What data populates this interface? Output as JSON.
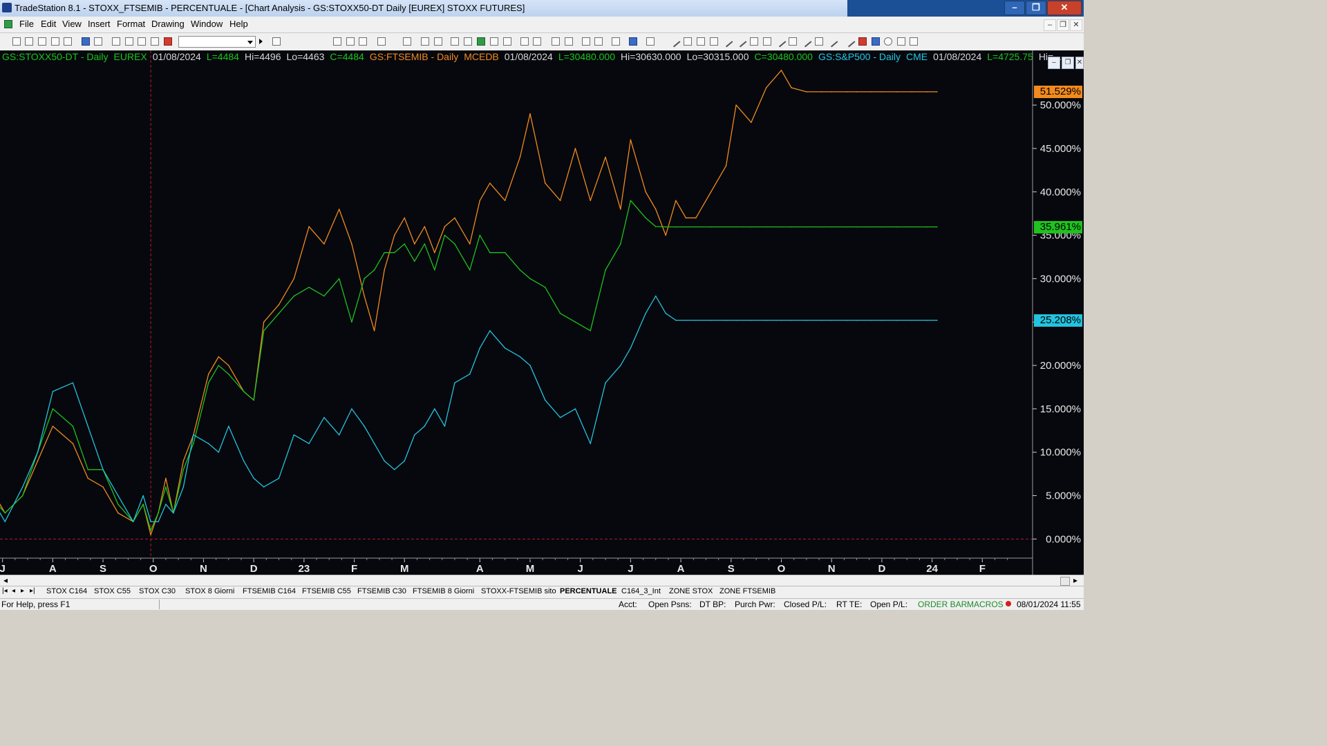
{
  "window": {
    "title": "TradeStation 8.1 - STOXX_FTSEMIB - PERCENTUALE - [Chart Analysis - GS:STOXX50-DT  Daily  [EUREX] STOXX FUTURES]",
    "minimize": "–",
    "restore": "❐",
    "close": "✕"
  },
  "menu": [
    "File",
    "Edit",
    "View",
    "Insert",
    "Format",
    "Drawing",
    "Window",
    "Help"
  ],
  "toolbar": {
    "symbol_value": ""
  },
  "info_bar": [
    {
      "text": "GS:STOXX50-DT - Daily",
      "color": "#19c619"
    },
    {
      "text": "EUREX",
      "color": "#19c619"
    },
    {
      "text": "01/08/2024",
      "color": "#d8d8d8"
    },
    {
      "text": "L=4484",
      "color": "#19c619"
    },
    {
      "text": "Hi=4496",
      "color": "#d8d8d8"
    },
    {
      "text": "Lo=4463",
      "color": "#d8d8d8"
    },
    {
      "text": "C=4484",
      "color": "#19c619"
    },
    {
      "text": "GS:FTSEMIB - Daily",
      "color": "#f28a1e"
    },
    {
      "text": "MCEDB",
      "color": "#f28a1e"
    },
    {
      "text": "01/08/2024",
      "color": "#d8d8d8"
    },
    {
      "text": "L=30480.000",
      "color": "#19c619"
    },
    {
      "text": "Hi=30630.000",
      "color": "#d8d8d8"
    },
    {
      "text": "Lo=30315.000",
      "color": "#d8d8d8"
    },
    {
      "text": "C=30480.000",
      "color": "#19c619"
    },
    {
      "text": "GS:S&P500 - Daily",
      "color": "#22c8e6"
    },
    {
      "text": "CME",
      "color": "#22c8e6"
    },
    {
      "text": "01/08/2024",
      "color": "#d8d8d8"
    },
    {
      "text": "L=4725.75",
      "color": "#19c619"
    },
    {
      "text": "Hi=...",
      "color": "#d8d8d8"
    }
  ],
  "chart_data": {
    "type": "line",
    "title": "",
    "ylabel": "",
    "ylim": [
      -2.2,
      55.5
    ],
    "y_ticks": [
      "50.000%",
      "45.000%",
      "40.000%",
      "35.000%",
      "30.000%",
      "25.000%",
      "20.000%",
      "15.000%",
      "10.000%",
      "5.000%",
      "0.000%"
    ],
    "y_tick_values": [
      50,
      45,
      40,
      35,
      30,
      25,
      20,
      15,
      10,
      5,
      0
    ],
    "x_labels": [
      "J",
      "A",
      "S",
      "O",
      "N",
      "D",
      "23",
      "F",
      "M",
      "A",
      "M",
      "J",
      "J",
      "A",
      "S",
      "O",
      "N",
      "D",
      "24",
      "F"
    ],
    "x_label_positions": [
      0.5,
      1.5,
      2.5,
      3.5,
      4.5,
      5.5,
      6.5,
      7.5,
      8.5,
      10,
      11,
      12,
      13,
      14,
      15,
      16,
      17,
      18,
      19,
      20
    ],
    "x_range": [
      0.45,
      21.0
    ],
    "vertical_marker_month": 3.45,
    "zero_line": 0,
    "grid": false,
    "series": [
      {
        "name": "GS:FTSEMIB",
        "color": "#f28a1e",
        "last_label": "51.529%",
        "last": 51.529,
        "x": [
          0,
          0.25,
          0.55,
          0.9,
          1.2,
          1.5,
          1.9,
          2.2,
          2.5,
          2.8,
          3.1,
          3.3,
          3.45,
          3.6,
          3.75,
          3.9,
          4.1,
          4.3,
          4.6,
          4.8,
          5.0,
          5.3,
          5.5,
          5.7,
          6.0,
          6.3,
          6.6,
          6.9,
          7.2,
          7.45,
          7.7,
          7.9,
          8.1,
          8.3,
          8.5,
          8.7,
          8.9,
          9.1,
          9.3,
          9.5,
          9.8,
          10.0,
          10.2,
          10.5,
          10.8,
          11.0,
          11.3,
          11.6,
          11.9,
          12.2,
          12.5,
          12.8,
          13.0,
          13.3,
          13.5,
          13.7,
          13.9,
          14.1,
          14.3,
          14.6,
          14.9,
          15.1,
          15.4,
          15.7,
          16.0,
          16.2,
          16.5,
          16.8,
          17.0,
          17.3,
          17.5,
          17.8,
          18.0,
          18.3,
          18.6,
          18.9,
          19.1
        ],
        "values": [
          19,
          6,
          3,
          5,
          9,
          13,
          11,
          7,
          6,
          3,
          2,
          4,
          0.5,
          3,
          7,
          3,
          9,
          12,
          19,
          21,
          20,
          17,
          16,
          25,
          27,
          30,
          36,
          34,
          38,
          34,
          28,
          24,
          31,
          35,
          37,
          34,
          36,
          33,
          36,
          37,
          34,
          39,
          41,
          39,
          44,
          49,
          41,
          39,
          45,
          39,
          44,
          38,
          46,
          40,
          38,
          35,
          39,
          37,
          37,
          40,
          43,
          50,
          48,
          52,
          54,
          52,
          51.529,
          51.529,
          51.529,
          51.529,
          51.529,
          51.529,
          51.529,
          51.529,
          51.529,
          51.529,
          51.529
        ]
      },
      {
        "name": "GS:STOXX50-DT",
        "color": "#1fc21f",
        "last_label": "35.961%",
        "last": 35.961,
        "x": [
          0,
          0.25,
          0.55,
          0.9,
          1.2,
          1.5,
          1.9,
          2.2,
          2.5,
          2.8,
          3.1,
          3.3,
          3.45,
          3.6,
          3.75,
          3.9,
          4.1,
          4.3,
          4.6,
          4.8,
          5.0,
          5.3,
          5.5,
          5.7,
          6.0,
          6.3,
          6.6,
          6.9,
          7.2,
          7.45,
          7.7,
          7.9,
          8.1,
          8.3,
          8.5,
          8.7,
          8.9,
          9.1,
          9.3,
          9.5,
          9.8,
          10.0,
          10.2,
          10.5,
          10.8,
          11.0,
          11.3,
          11.6,
          11.9,
          12.2,
          12.5,
          12.8,
          13.0,
          13.3,
          13.5,
          13.7,
          13.9,
          14.1,
          14.3,
          14.6,
          14.9,
          15.1,
          15.4,
          15.7,
          16.0,
          16.2,
          16.5,
          16.8,
          17.0,
          17.3,
          17.5,
          17.8,
          18.0,
          18.3,
          18.6,
          18.9,
          19.1
        ],
        "values": [
          17,
          5,
          3,
          5,
          10,
          15,
          13,
          8,
          8,
          4,
          2,
          4,
          1,
          3,
          6,
          3,
          8,
          11,
          18,
          20,
          19,
          17,
          16,
          24,
          26,
          28,
          29,
          28,
          30,
          25,
          30,
          31,
          33,
          33,
          34,
          32,
          34,
          31,
          35,
          34,
          31,
          35,
          33,
          33,
          31,
          30,
          29,
          26,
          25,
          24,
          31,
          34,
          39,
          37,
          36,
          35.961,
          35.961,
          35.961,
          35.961,
          35.961,
          35.961,
          35.961,
          35.961,
          35.961,
          35.961,
          35.961,
          35.961,
          35.961,
          35.961,
          35.961,
          35.961,
          35.961,
          35.961,
          35.961,
          35.961,
          35.961,
          35.961
        ]
      },
      {
        "name": "GS:S&P500",
        "color": "#24c3df",
        "last_label": "25.208%",
        "last": 25.208,
        "x": [
          0,
          0.25,
          0.55,
          0.9,
          1.2,
          1.5,
          1.9,
          2.2,
          2.5,
          2.8,
          3.1,
          3.3,
          3.45,
          3.6,
          3.75,
          3.9,
          4.1,
          4.3,
          4.6,
          4.8,
          5.0,
          5.3,
          5.5,
          5.7,
          6.0,
          6.3,
          6.6,
          6.9,
          7.2,
          7.45,
          7.7,
          7.9,
          8.1,
          8.3,
          8.5,
          8.7,
          8.9,
          9.1,
          9.3,
          9.5,
          9.8,
          10.0,
          10.2,
          10.5,
          10.8,
          11.0,
          11.3,
          11.6,
          11.9,
          12.2,
          12.5,
          12.8,
          13.0,
          13.3,
          13.5,
          13.7,
          13.9,
          14.1,
          14.3,
          14.6,
          14.9,
          15.1,
          15.4,
          15.7,
          16.0,
          16.2,
          16.5,
          16.8,
          17.0,
          17.3,
          17.5,
          17.8,
          18.0,
          18.3,
          18.6,
          18.9,
          19.1
        ],
        "values": [
          15,
          5,
          2,
          6,
          10,
          17,
          18,
          13,
          8,
          5,
          2,
          5,
          2,
          2,
          4,
          3,
          6,
          12,
          11,
          10,
          13,
          9,
          7,
          6,
          7,
          12,
          11,
          14,
          12,
          15,
          13,
          11,
          9,
          8,
          9,
          12,
          13,
          15,
          13,
          18,
          19,
          22,
          24,
          22,
          21,
          20,
          16,
          14,
          15,
          11,
          18,
          20,
          22,
          26,
          28,
          26,
          25.208,
          25.208,
          25.208,
          25.208,
          25.208,
          25.208,
          25.208,
          25.208,
          25.208,
          25.208,
          25.208,
          25.208,
          25.208,
          25.208,
          25.208,
          25.208,
          25.208,
          25.208,
          25.208,
          25.208,
          25.208
        ]
      }
    ]
  },
  "tabs": [
    {
      "label": "STOX C164",
      "active": false
    },
    {
      "label": "STOX C55",
      "active": false
    },
    {
      "label": "STOX  C30",
      "active": false
    },
    {
      "label": "STOX  8 Giorni",
      "active": false
    },
    {
      "label": "FTSEMIB C164",
      "active": false
    },
    {
      "label": "FTSEMIB C55",
      "active": false
    },
    {
      "label": "FTSEMIB C30",
      "active": false
    },
    {
      "label": "FTSEMIB  8 Giorni",
      "active": false
    },
    {
      "label": "STOXX-FTSEMIB sito",
      "active": false
    },
    {
      "label": "PERCENTUALE",
      "active": true
    },
    {
      "label": "C164_3_Int",
      "active": false
    },
    {
      "label": "ZONE STOX",
      "active": false
    },
    {
      "label": "ZONE FTSEMIB",
      "active": false
    }
  ],
  "status": {
    "help": "For Help, press F1",
    "acct": "Acct:",
    "open_psns": "Open Psns:",
    "dt_bp": "DT BP:",
    "purch_pwr": "Purch Pwr:",
    "closed_pl": "Closed P/L:",
    "rt_te": "RT TE:",
    "open_pl": "Open P/L:",
    "order_bar": "ORDER BAR",
    "macros": "MACROS",
    "datetime": "08/01/2024 11:55"
  }
}
